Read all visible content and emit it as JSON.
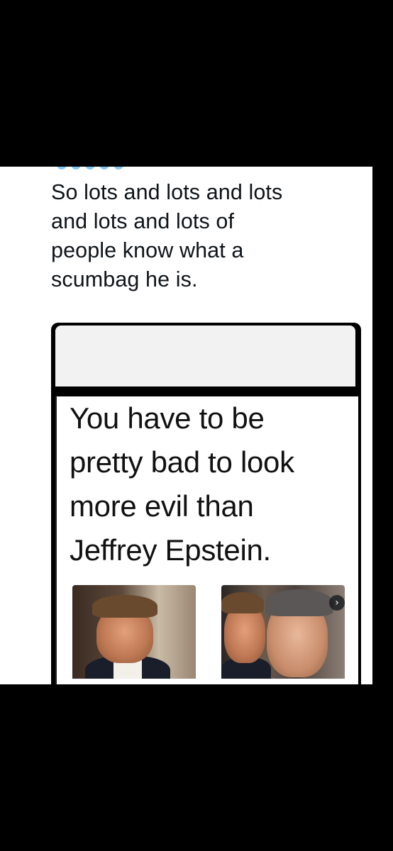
{
  "post": {
    "text_lines": [
      "So lots and lots and lots",
      "and lots and lots of",
      "people know what a",
      "scumbag he is."
    ]
  },
  "media": {
    "meme_lines": [
      "You have to be",
      "pretty bad to look",
      "more evil than",
      "Jeffrey Epstein."
    ],
    "next_icon": "chevron-right-icon",
    "next_glyph": "›"
  },
  "colors": {
    "background": "#000000",
    "panel": "#ffffff",
    "text": "#0f1419",
    "link": "#1d9bf0"
  }
}
